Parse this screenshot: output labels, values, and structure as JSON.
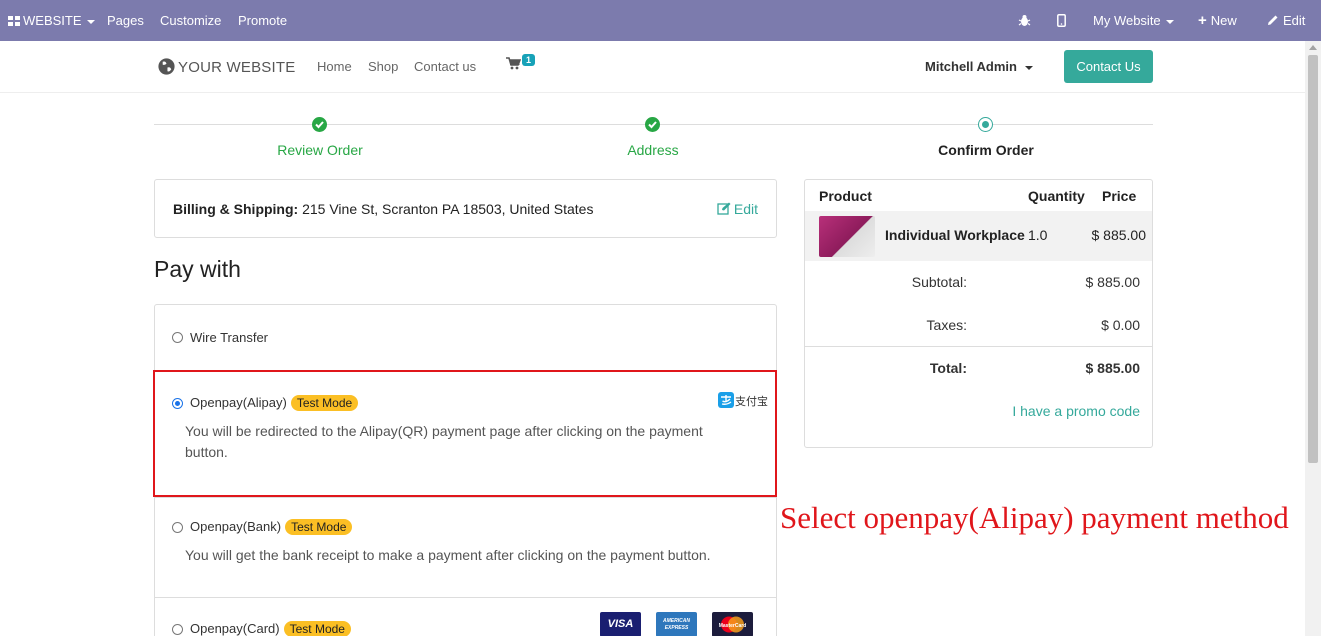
{
  "admin_bar": {
    "website_menu": "WEBSITE",
    "pages": "Pages",
    "customize": "Customize",
    "promote": "Promote",
    "my_website": "My Website",
    "new": "New",
    "edit": "Edit"
  },
  "header": {
    "logo": "YOUR WEBSITE",
    "nav": [
      "Home",
      "Shop",
      "Contact us"
    ],
    "cart_count": "1",
    "user": "Mitchell Admin",
    "contact_button": "Contact Us"
  },
  "steps": [
    {
      "label": "Review Order",
      "state": "done"
    },
    {
      "label": "Address",
      "state": "done"
    },
    {
      "label": "Confirm Order",
      "state": "current"
    }
  ],
  "billing": {
    "label": "Billing & Shipping:",
    "address": "215 Vine St, Scranton PA 18503, United States",
    "edit": "Edit"
  },
  "pay_with": "Pay with",
  "payment_methods": [
    {
      "name": "Wire Transfer",
      "badge": "",
      "description": "",
      "selected": false
    },
    {
      "name": "Openpay(Alipay)",
      "badge": "Test Mode",
      "description": "You will be redirected to the Alipay(QR) payment page after clicking on the payment button.",
      "selected": true,
      "logo_text": "支付宝"
    },
    {
      "name": "Openpay(Bank)",
      "badge": "Test Mode",
      "description": "You will get the bank receipt to make a payment after clicking on the payment button.",
      "selected": false
    },
    {
      "name": "Openpay(Card)",
      "badge": "Test Mode",
      "description": "",
      "selected": false,
      "card_logos": [
        "VISA",
        "AMERICAN EXPRESS",
        "MasterCard"
      ]
    }
  ],
  "annotation": "Select openpay(Alipay) payment method",
  "summary": {
    "headers": {
      "product": "Product",
      "quantity": "Quantity",
      "price": "Price"
    },
    "item": {
      "name": "Individual Workplace",
      "quantity": "1.0",
      "price": "$ 885.00"
    },
    "subtotal_label": "Subtotal:",
    "subtotal": "$ 885.00",
    "taxes_label": "Taxes:",
    "taxes": "$ 0.00",
    "total_label": "Total:",
    "total": "$ 885.00",
    "promo": "I have a promo code"
  },
  "colors": {
    "admin_bar": "#7c7bad",
    "accent": "#35a99b",
    "success": "#28a745",
    "badge": "#fbbf24",
    "annotation": "#e0161b"
  }
}
